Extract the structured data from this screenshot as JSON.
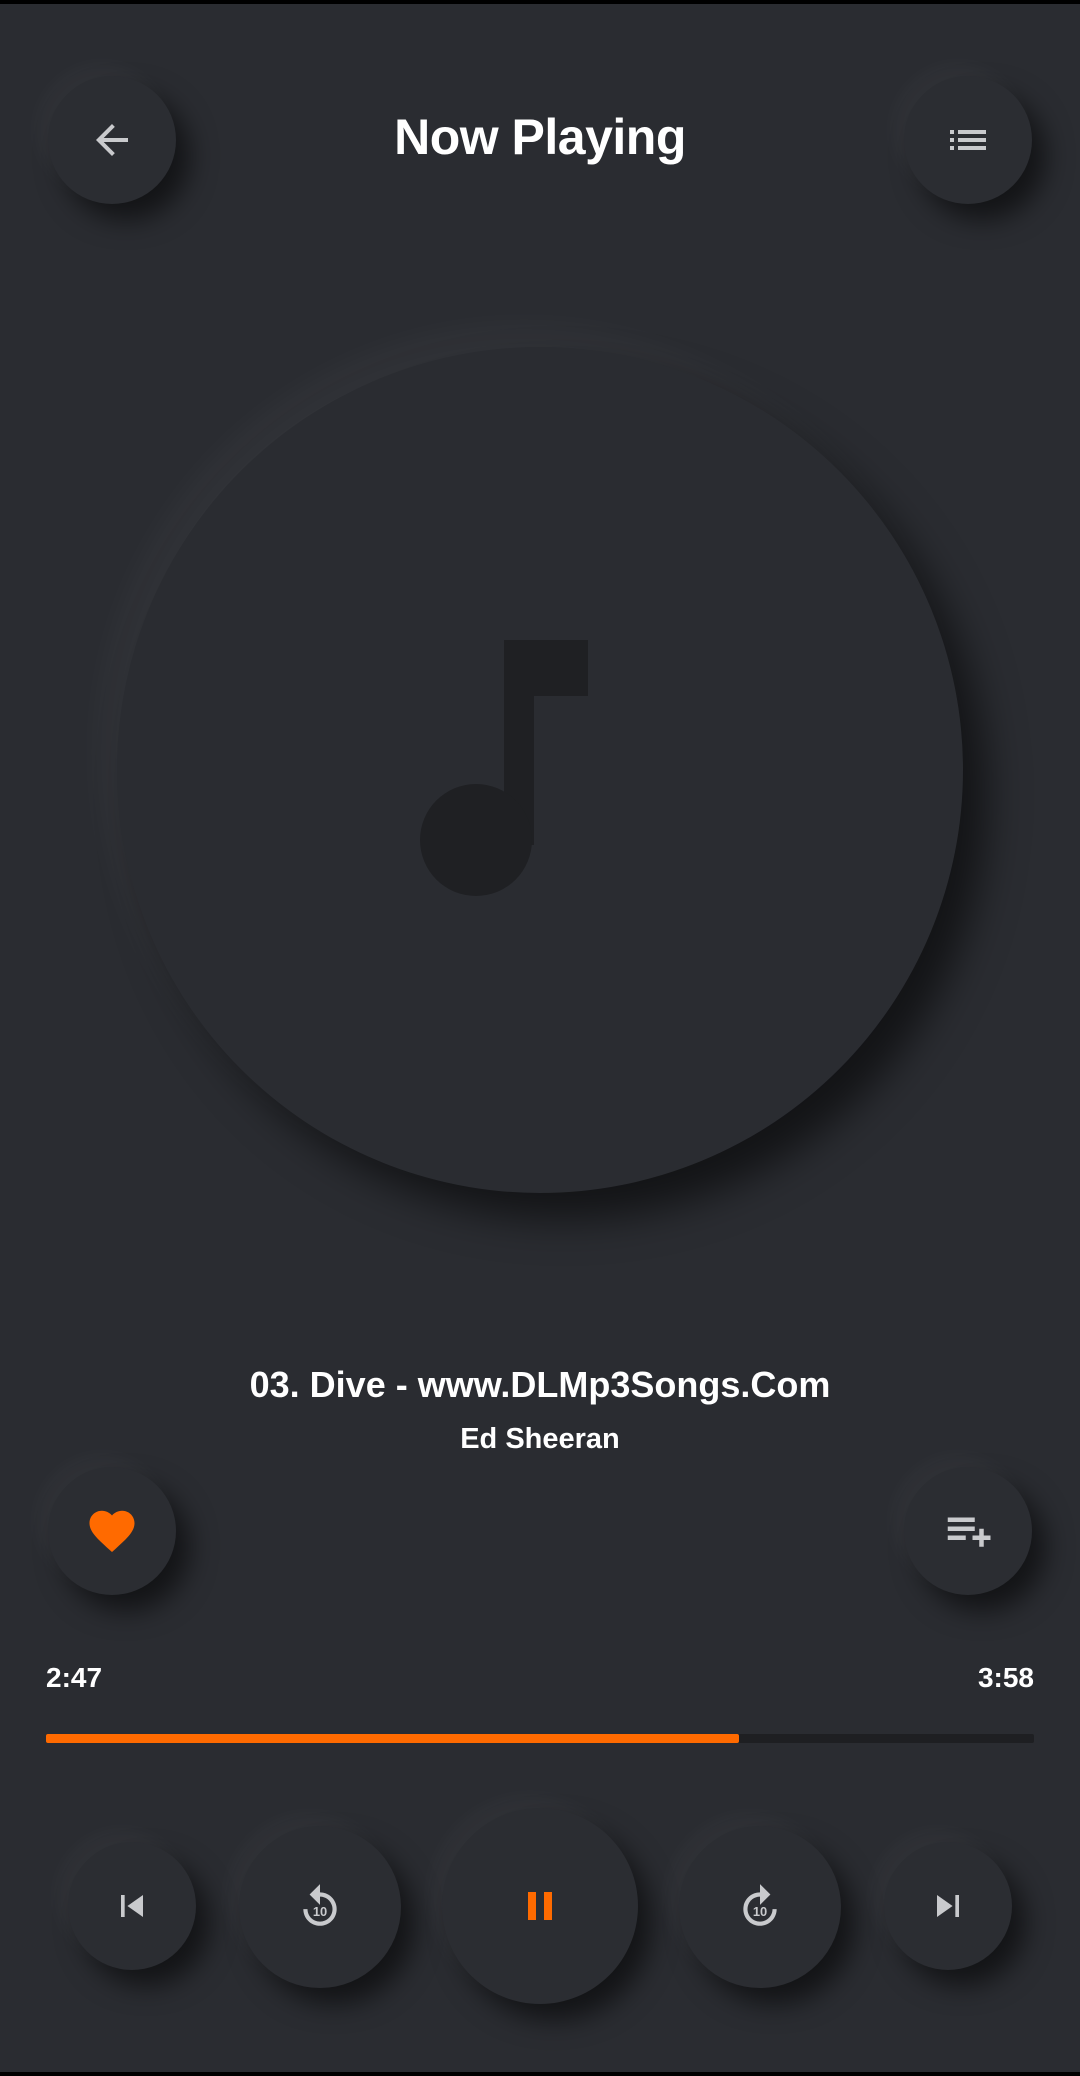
{
  "header": {
    "title": "Now Playing",
    "back_icon": "arrow-left-icon",
    "queue_icon": "list-icon"
  },
  "album_art": {
    "placeholder_icon": "music-note-icon"
  },
  "track": {
    "title": "03. Dive - www.DLMp3Songs.Com",
    "artist": "Ed Sheeran"
  },
  "actions": {
    "favorite_icon": "heart-icon",
    "favorite_active": true,
    "add_to_playlist_icon": "playlist-add-icon"
  },
  "progress": {
    "current_time": "2:47",
    "total_time": "3:58",
    "fraction": 0.701
  },
  "controls": {
    "previous_icon": "skip-previous-icon",
    "rewind_icon": "replay-10-icon",
    "rewind_label": "10",
    "play_pause_icon": "pause-icon",
    "forward_icon": "forward-10-icon",
    "forward_label": "10",
    "next_icon": "skip-next-icon"
  },
  "colors": {
    "background": "#2a2c31",
    "accent": "#ff6a00",
    "icon": "#c9cacd",
    "track_empty": "#1e1f22",
    "text": "#ffffff"
  }
}
